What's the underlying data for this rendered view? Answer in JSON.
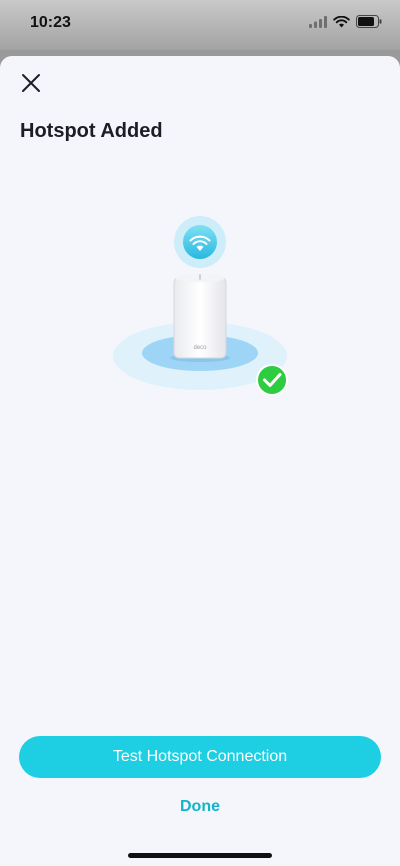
{
  "status_bar": {
    "time": "10:23",
    "icons": [
      "cellular-signal-icon",
      "wifi-icon",
      "battery-icon"
    ]
  },
  "header": {
    "close_icon": "close-icon",
    "title": "Hotspot Added"
  },
  "illustration": {
    "icons": [
      "wifi-badge-icon",
      "mesh-router-icon",
      "success-check-icon"
    ],
    "device_brand": "deco"
  },
  "actions": {
    "primary_label": "Test Hotspot Connection",
    "secondary_label": "Done"
  },
  "colors": {
    "accent": "#1ecfe3",
    "link": "#12b4c9",
    "success": "#2ecc40",
    "background": "#f5f6fb",
    "title_text": "#1d1d26"
  }
}
